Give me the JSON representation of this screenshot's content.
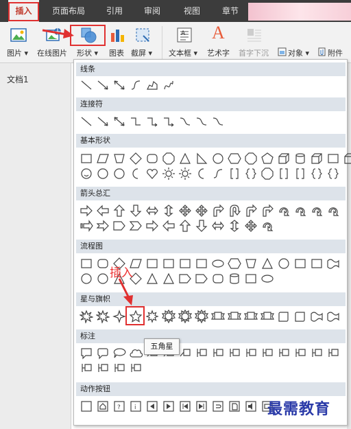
{
  "tabs": [
    {
      "label": "插入",
      "active": true
    },
    {
      "label": "页面布局"
    },
    {
      "label": "引用"
    },
    {
      "label": "审阅"
    },
    {
      "label": "视图"
    },
    {
      "label": "章节"
    }
  ],
  "ribbon": {
    "picture": "图片",
    "online_picture": "在线图片",
    "shapes": "形状",
    "chart": "图表",
    "screenshot": "截屏",
    "textbox": "文本框",
    "wordart": "艺术字",
    "dropcap": "首字下沉",
    "object": "对象",
    "attachment": "附件",
    "dropdown_arrow": "▾",
    "wordart_glyph": "A"
  },
  "document_tab": "文档1",
  "sections": [
    {
      "label": "线条"
    },
    {
      "label": "连接符"
    },
    {
      "label": "基本形状"
    },
    {
      "label": "箭头总汇"
    },
    {
      "label": "流程图"
    },
    {
      "label": "星与旗帜"
    },
    {
      "label": "标注"
    },
    {
      "label": "动作按钮"
    }
  ],
  "tooltip": "五角星",
  "annotation": "插入",
  "watermark": "最需教育",
  "colors": {
    "highlight": "#e03030",
    "accent": "#2e6db4",
    "watermark": "#2a3aa8"
  }
}
